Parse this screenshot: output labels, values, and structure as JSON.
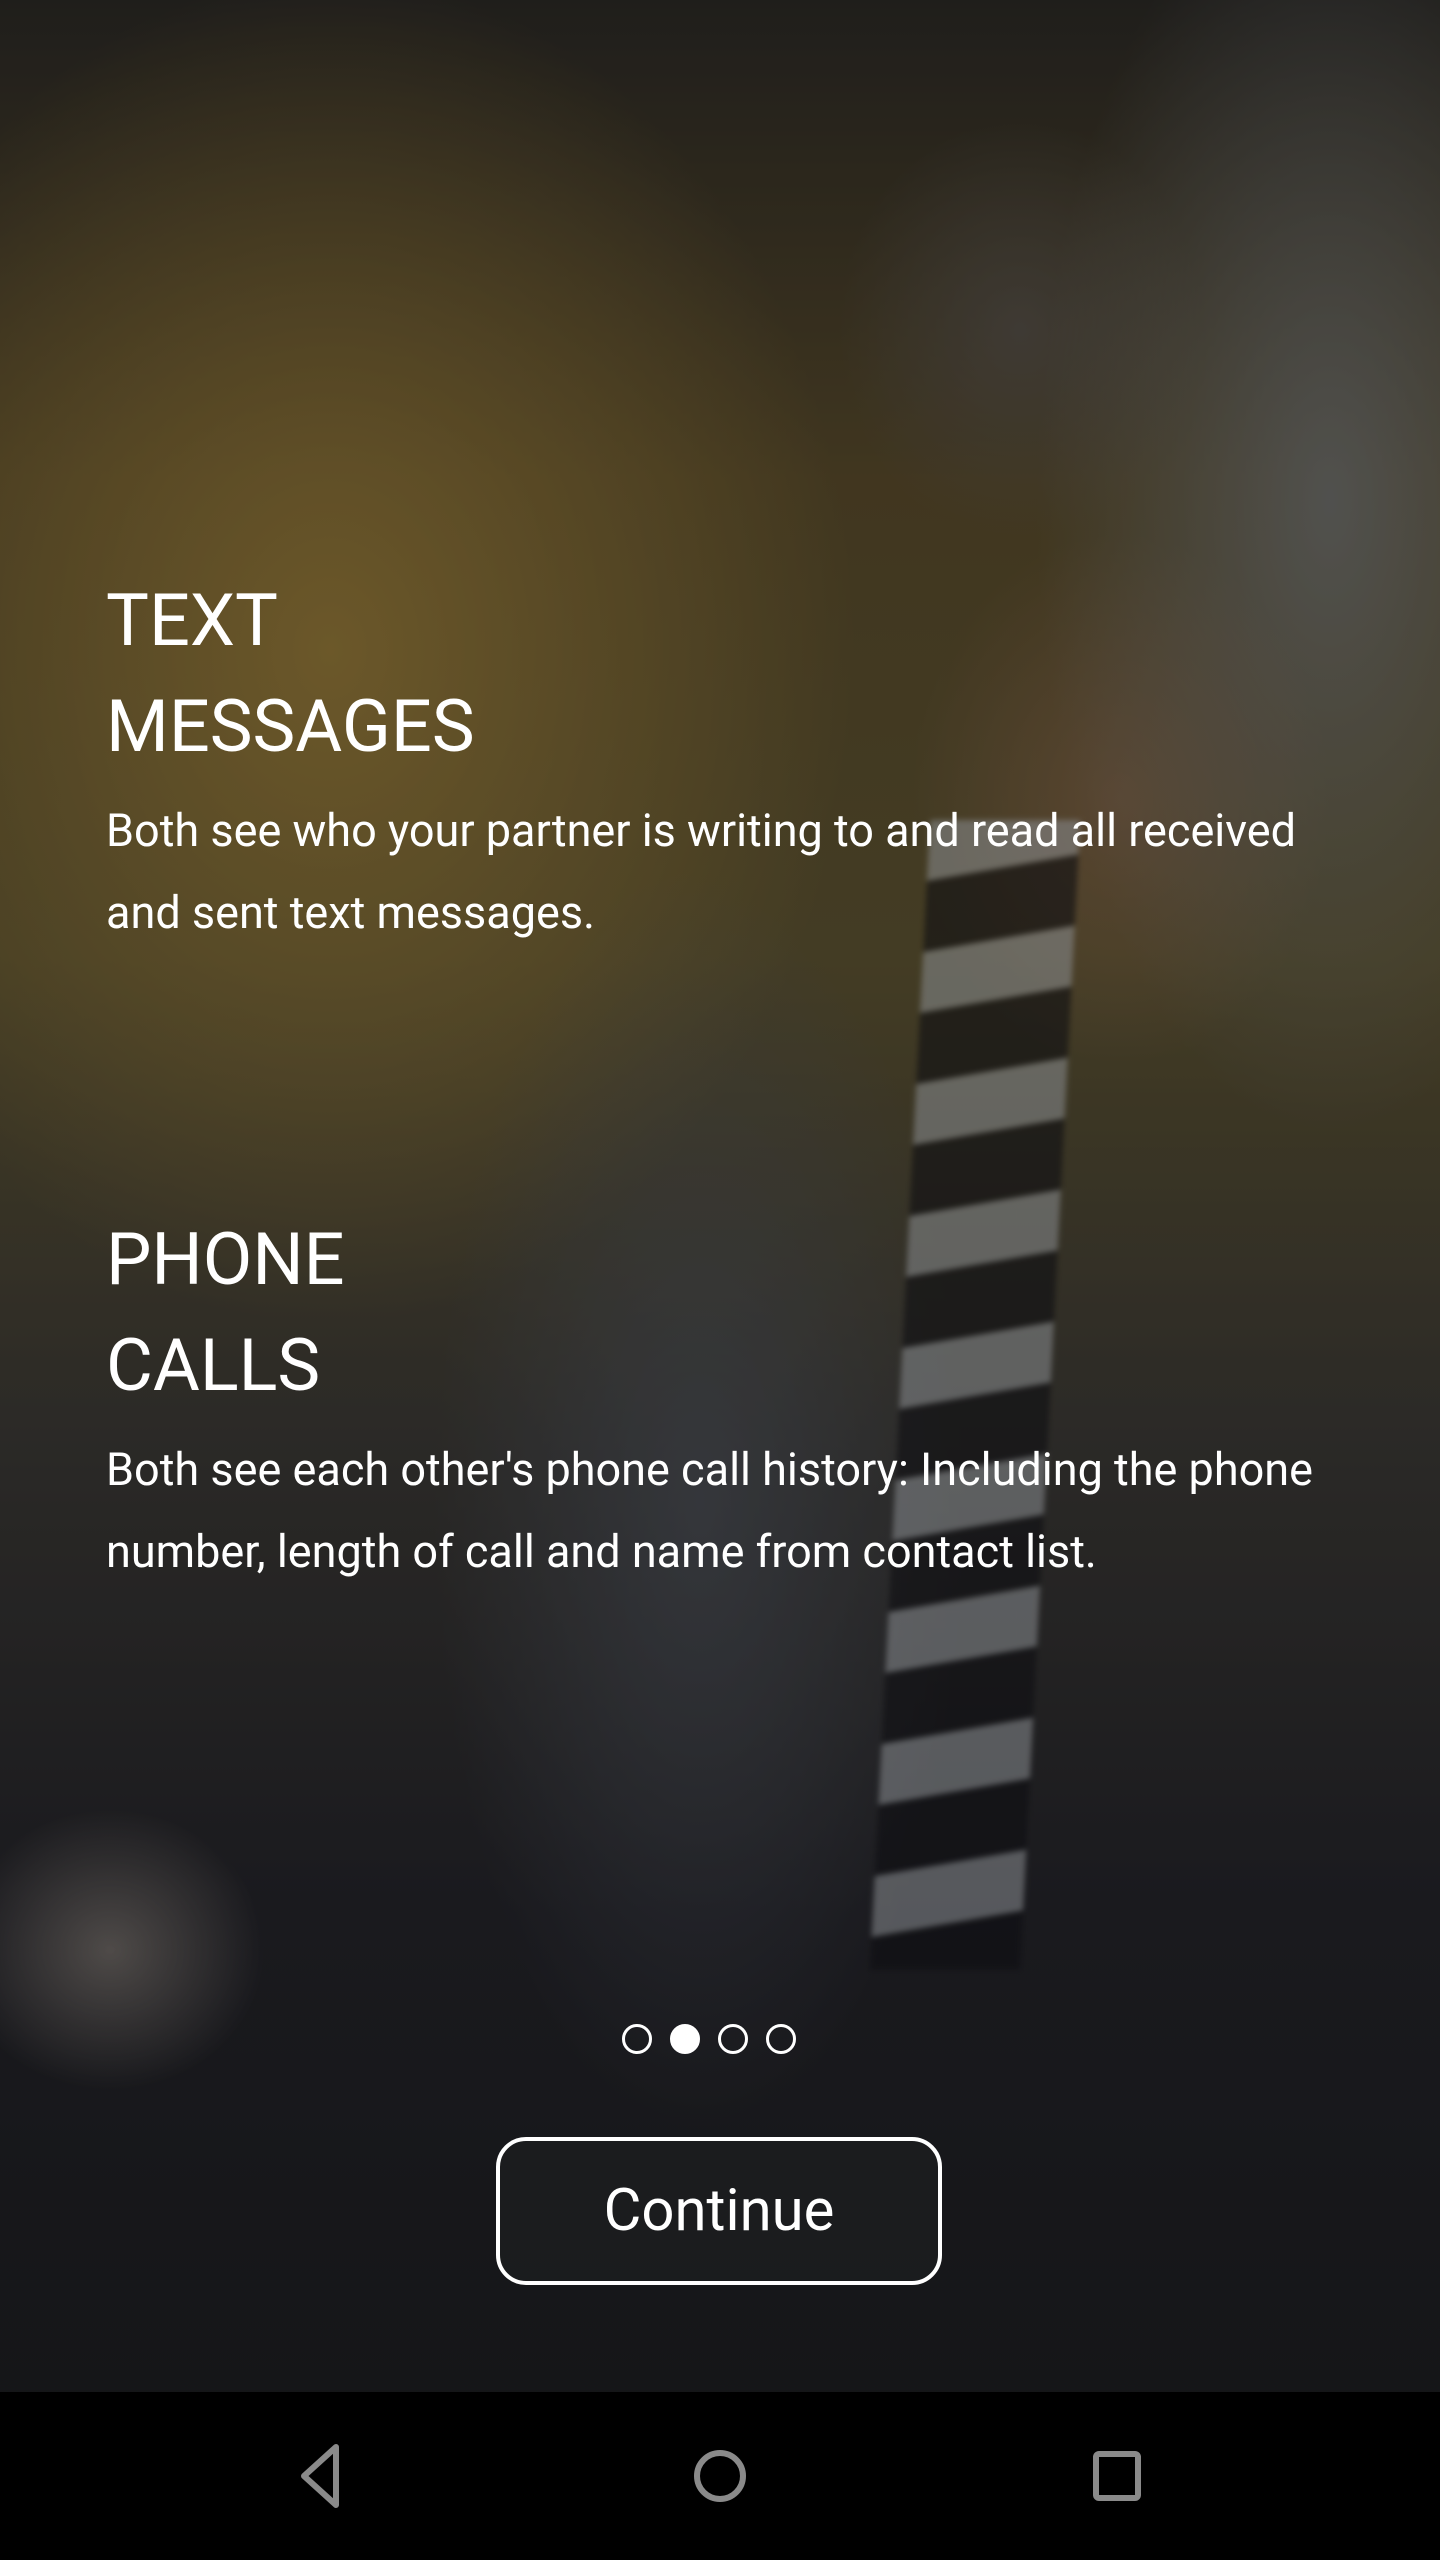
{
  "background": {
    "image": "couple-looking-at-phone-photo"
  },
  "features": [
    {
      "title_line1": "TEXT",
      "title_line2": "MESSAGES",
      "body": "Both see who your partner is writing to and read all received and sent text messages."
    },
    {
      "title_line1": "PHONE",
      "title_line2": "CALLS",
      "body": "Both see each other's phone call history: Including the phone number, length of call and name from contact list."
    }
  ],
  "pager": {
    "total": 4,
    "active_index": 1
  },
  "continue_label": "Continue",
  "nav_bar": {
    "icons": [
      "back-icon",
      "home-icon",
      "recents-icon"
    ]
  },
  "colors": {
    "text": "#ffffff",
    "nav_bar": "#000000",
    "nav_icon": "#8a8a8a"
  }
}
